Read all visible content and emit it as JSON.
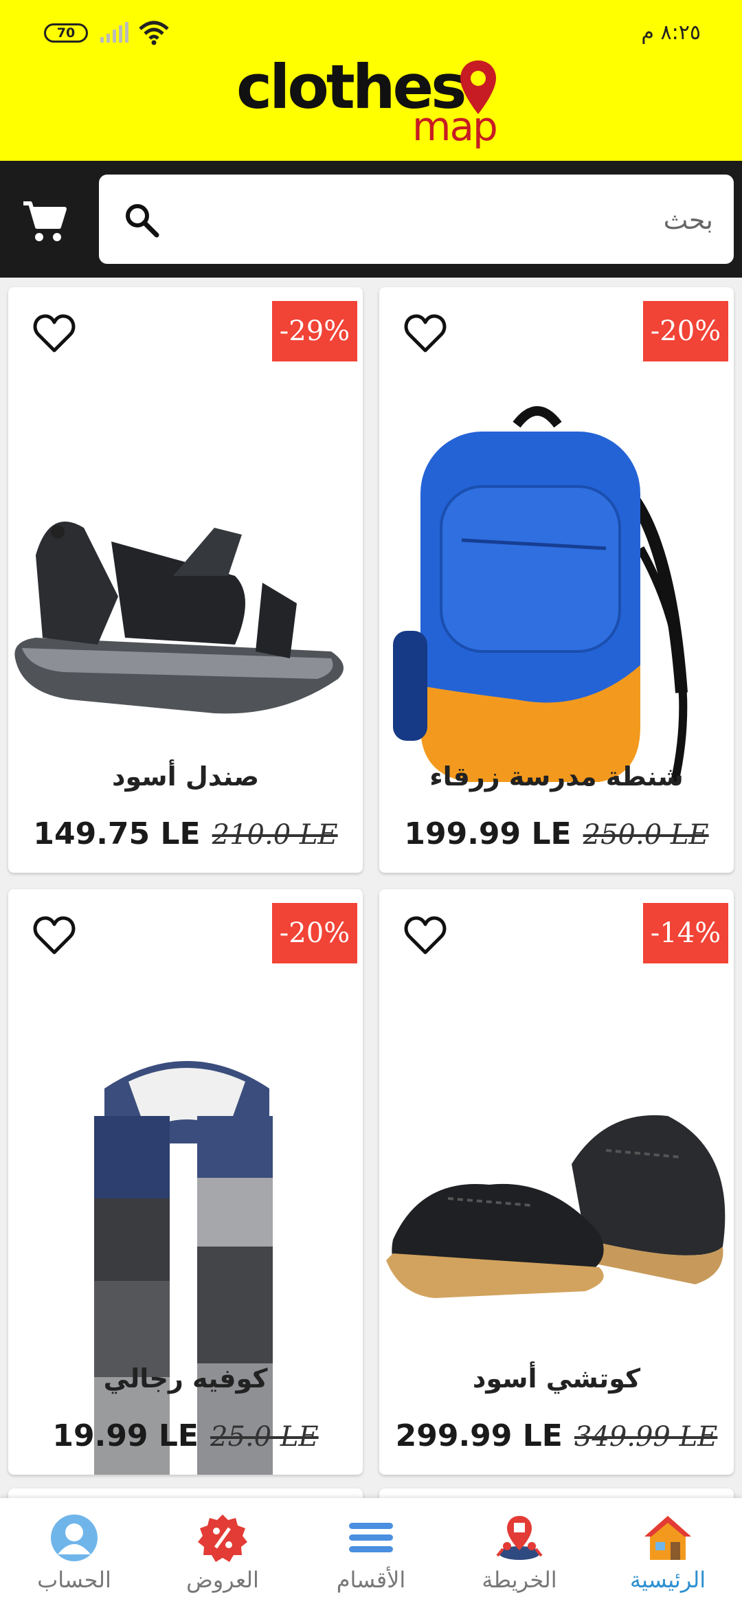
{
  "status_bar": {
    "time": "٨:٢٥ م",
    "battery": "70"
  },
  "app": {
    "logo_word": "clothes",
    "logo_sub": "map"
  },
  "search": {
    "placeholder": "بحث"
  },
  "products": [
    {
      "name": "شنطة مدرسة زرقاء",
      "price": "199.99 LE",
      "old_price": "250.0 LE",
      "discount": "-20%"
    },
    {
      "name": "صندل أسود",
      "price": "149.75 LE",
      "old_price": "210.0 LE",
      "discount": "-29%"
    },
    {
      "name": "كوتشي أسود",
      "price": "299.99 LE",
      "old_price": "349.99 LE",
      "discount": "-14%"
    },
    {
      "name": "كوفيه رجالي",
      "price": "19.99 LE",
      "old_price": "25.0 LE",
      "discount": "-20%"
    }
  ],
  "nav": {
    "home": "الرئيسية",
    "map": "الخريطة",
    "categories": "الأقسام",
    "offers": "العروض",
    "account": "الحساب"
  },
  "colors": {
    "header_bg": "#ffff00",
    "searchbar_bg": "#1b1b1b",
    "badge": "#f14336",
    "active_nav": "#2d8fd0"
  }
}
